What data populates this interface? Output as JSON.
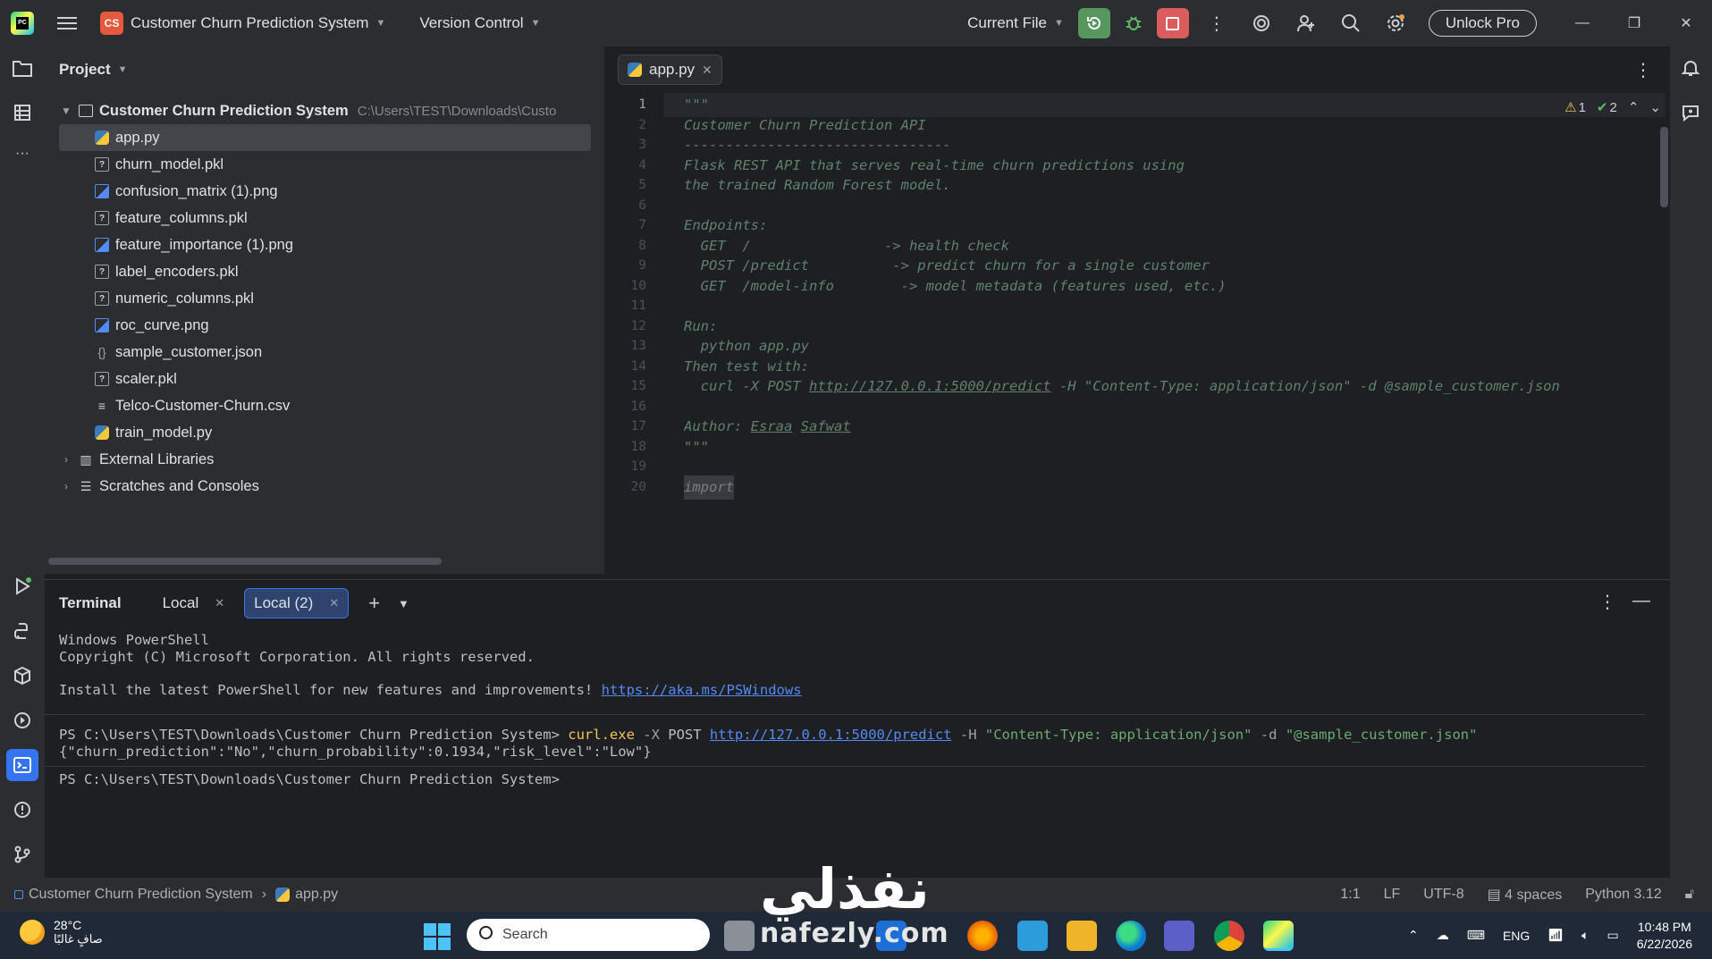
{
  "titlebar": {
    "project_badge": "CS",
    "project_name": "Customer Churn Prediction System",
    "vcs": "Version Control",
    "run_config": "Current File",
    "unlock": "Unlock Pro"
  },
  "project_panel": {
    "title": "Project",
    "root": "Customer Churn Prediction System",
    "root_path": "C:\\Users\\TEST\\Downloads\\Custo",
    "files": [
      {
        "name": "app.py",
        "icon": "python-file-icon"
      },
      {
        "name": "churn_model.pkl",
        "icon": "unknown-file-icon"
      },
      {
        "name": "confusion_matrix (1).png",
        "icon": "image-file-icon"
      },
      {
        "name": "feature_columns.pkl",
        "icon": "unknown-file-icon"
      },
      {
        "name": "feature_importance (1).png",
        "icon": "image-file-icon"
      },
      {
        "name": "label_encoders.pkl",
        "icon": "unknown-file-icon"
      },
      {
        "name": "numeric_columns.pkl",
        "icon": "unknown-file-icon"
      },
      {
        "name": "roc_curve.png",
        "icon": "image-file-icon"
      },
      {
        "name": "sample_customer.json",
        "icon": "json-file-icon"
      },
      {
        "name": "scaler.pkl",
        "icon": "unknown-file-icon"
      },
      {
        "name": "Telco-Customer-Churn.csv",
        "icon": "text-file-icon"
      },
      {
        "name": "train_model.py",
        "icon": "python-file-icon"
      }
    ],
    "external_libraries": "External Libraries",
    "scratches": "Scratches and Consoles"
  },
  "editor": {
    "tab": "app.py",
    "warnings": "1",
    "checks": "2",
    "line_numbers": [
      "1",
      "2",
      "3",
      "4",
      "5",
      "6",
      "7",
      "8",
      "9",
      "10",
      "11",
      "12",
      "13",
      "14",
      "15",
      "16",
      "17",
      "18",
      "19",
      "20"
    ],
    "lines": [
      "\"\"\"",
      "Customer Churn Prediction API",
      "--------------------------------",
      "Flask REST API that serves real-time churn predictions using",
      "the trained Random Forest model.",
      "",
      "Endpoints:",
      "  GET  /                -> health check",
      "  POST /predict          -> predict churn for a single customer",
      "  GET  /model-info        -> model metadata (features used, etc.)",
      "",
      "Run:",
      "  python app.py",
      "Then test with:",
      "  curl -X POST ",
      "",
      "Author: ",
      "\"\"\"",
      "",
      "import"
    ],
    "line15_url": "http://127.0.0.1:5000/predict",
    "line15_rest": " -H \"Content-Type: application/json\" -d @sample_customer.json",
    "author_first": "Esraa",
    "author_last": "Safwat"
  },
  "terminal": {
    "title": "Terminal",
    "tabs": [
      "Local",
      "Local (2)"
    ],
    "line1": "Windows PowerShell",
    "line2": "Copyright (C) Microsoft Corporation. All rights reserved.",
    "line3_text": "Install the latest PowerShell for new features and improvements! ",
    "line3_link": "https://aka.ms/PSWindows",
    "prompt1": "PS C:\\Users\\TEST\\Downloads\\Customer Churn Prediction System> ",
    "cmd_exe": "curl.exe",
    "cmd_x": " -X ",
    "cmd_post": "POST ",
    "cmd_url": "http://127.0.0.1:5000/predict",
    "cmd_h": " -H ",
    "cmd_header": "\"Content-Type: application/json\"",
    "cmd_d": " -d ",
    "cmd_file": "\"@sample_customer.json\"",
    "response": "{\"churn_prediction\":\"No\",\"churn_probability\":0.1934,\"risk_level\":\"Low\"}",
    "prompt2": "PS C:\\Users\\TEST\\Downloads\\Customer Churn Prediction System>"
  },
  "statusbar": {
    "project": "Customer Churn Prediction System",
    "file": "app.py",
    "position": "1:1",
    "line_sep": "LF",
    "encoding": "UTF-8",
    "indent": "4 spaces",
    "interpreter": "Python 3.12"
  },
  "taskbar": {
    "temp": "28°C",
    "weather": "صافٍ غالبًا",
    "search": "Search",
    "lang": "ENG",
    "time": "10:48 PM",
    "date": "6/22/2026"
  },
  "watermark": {
    "arabic": "نفذلي",
    "latin": "nafezly.com"
  },
  "colors": {
    "accent": "#3574f0",
    "run": "#57965c",
    "stop": "#db5c5c",
    "comment": "#5f826b"
  }
}
